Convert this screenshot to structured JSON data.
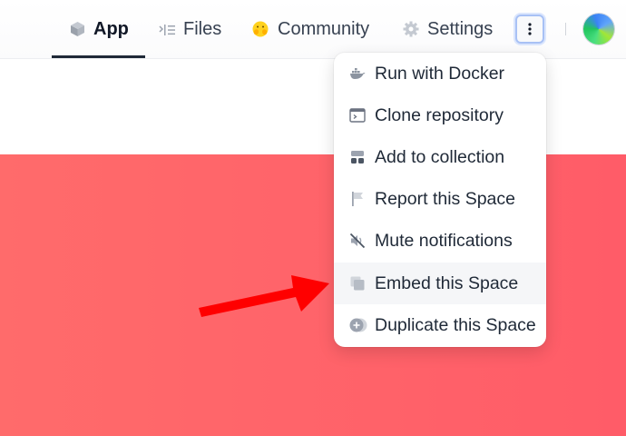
{
  "tabs": [
    {
      "id": "app",
      "label": "App",
      "icon": "cube-icon",
      "active": true
    },
    {
      "id": "files",
      "label": "Files",
      "icon": "files-list-icon",
      "active": false
    },
    {
      "id": "community",
      "label": "Community",
      "icon": "hug-emoji-icon",
      "active": false
    },
    {
      "id": "settings",
      "label": "Settings",
      "icon": "gear-icon",
      "active": false
    }
  ],
  "more_button": {
    "icon": "vertical-ellipsis-icon"
  },
  "avatar": {
    "icon": "space-avatar-icon"
  },
  "menu": {
    "items": [
      {
        "label": "Run with Docker",
        "icon": "docker-icon"
      },
      {
        "label": "Clone repository",
        "icon": "terminal-icon"
      },
      {
        "label": "Add to collection",
        "icon": "collection-icon"
      },
      {
        "label": "Report this Space",
        "icon": "flag-icon"
      },
      {
        "label": "Mute notifications",
        "icon": "mute-icon"
      },
      {
        "label": "Embed this Space",
        "icon": "embed-icon",
        "highlighted": true
      },
      {
        "label": "Duplicate this Space",
        "icon": "duplicate-icon"
      }
    ]
  },
  "colors": {
    "hero": "#ff6b6b",
    "arrow": "#ff0000",
    "accent_ring": "#a8c1f5"
  }
}
